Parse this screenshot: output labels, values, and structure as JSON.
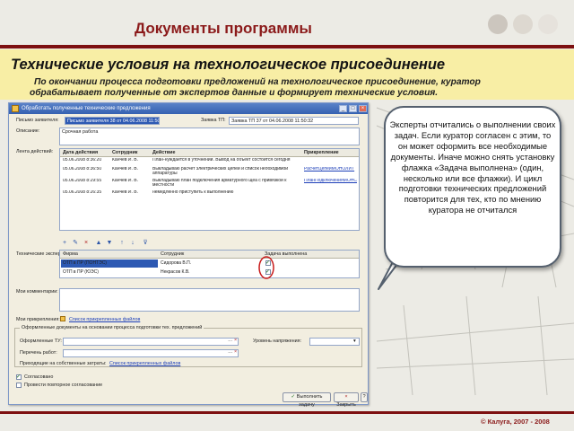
{
  "header": {
    "title": "Документы программы",
    "accent": "#8b1a1a"
  },
  "slide": {
    "subtitle": "Технические условия на технологическое присоединение",
    "description": "По окончании процесса подготовки предложений на технологическое присоединение, куратор обрабатывает полученные от экспертов данные и формирует технические условия.",
    "band_color": "#f8eea5"
  },
  "dialog": {
    "title": "Обработать полученные технические предложения",
    "letter_label": "Письмо заявителя:",
    "letter_value": "Письмо заявителя 38 от 04.06.2008 11:50:44",
    "request_label": "Заявка ТП:",
    "request_value": "Заявка ТП 37 от 04.06.2008 11:50:32",
    "description_label": "Описание:",
    "description_value": "Срочная работа",
    "actions_label": "Лента действий:",
    "actions_columns": [
      "Дата действия",
      "Сотрудник",
      "Действие",
      "Прикрепление"
    ],
    "actions_rows": [
      {
        "date": "05.06.2008 8:36:20",
        "employee": "Канчев И. В.",
        "action": "План-нуждается в уточнении. Вывод на объект состоится сегодня",
        "attach": ""
      },
      {
        "date": "05.06.2008 8:36:50",
        "employee": "Канчев И. В.",
        "action": "Выкладываю расчет электрических цепей и список необходимой аппаратуры",
        "attach": "РасчетЦепейМОНОЛИТ"
      },
      {
        "date": "05.06.2008 8:29:55",
        "employee": "Канчев И. В.",
        "action": "Выкладываю план подключения арматурного щеа с привязкой к местности",
        "attach": "ПланПодключенияМОНС"
      },
      {
        "date": "05.06.2008 8:26:35",
        "employee": "Канчев И. В.",
        "action": "немедленно приступить к выполнению",
        "attach": ""
      }
    ],
    "experts_label": "Технические эксперты:",
    "experts_columns": [
      "Фирма",
      "Сотрудник",
      "Задача выполнена"
    ],
    "experts_rows": [
      {
        "firm": "ОТП в ПР (ПОНТЭС)",
        "employee": "Сидорова В.П.",
        "done": true
      },
      {
        "firm": "ОТП в ПР (ЮЭС)",
        "employee": "Некрасов К.В.",
        "done": true
      }
    ],
    "comment_label": "Мои комментарии:",
    "attach_label": "Мои прикрепления:",
    "attach_link": "Список прикрепленных файлов",
    "group_title": "Оформленные документы на основании процесса подготовки тех. предложений",
    "tu_label": "Оформленные ТУ:",
    "voltage_label": "Уровень напряжения:",
    "works_label": "Перечень работ:",
    "files_label": "Приходящие на собственные затраты:",
    "files_link": "Список прикрепленных файлов",
    "agreement_label": "Согласовано",
    "repeat_label": "Провести повторное согласование",
    "ok_button": "Выполнить задачу",
    "cancel_button": "Закрыть",
    "help_button": "?"
  },
  "callout": {
    "text": "Эксперты отчитались о выполнении своих задач. Если куратор согласен с этим, то он может оформить все необходимые документы. Иначе можно снять установку флажка «Задача выполнена» (один, несколько или все флажки). И цикл подготовки технических предложений повторится для тех, кто по мнению куратора не отчитался"
  },
  "footer": {
    "copyright": "© Калуга, 2007 - 2008"
  }
}
